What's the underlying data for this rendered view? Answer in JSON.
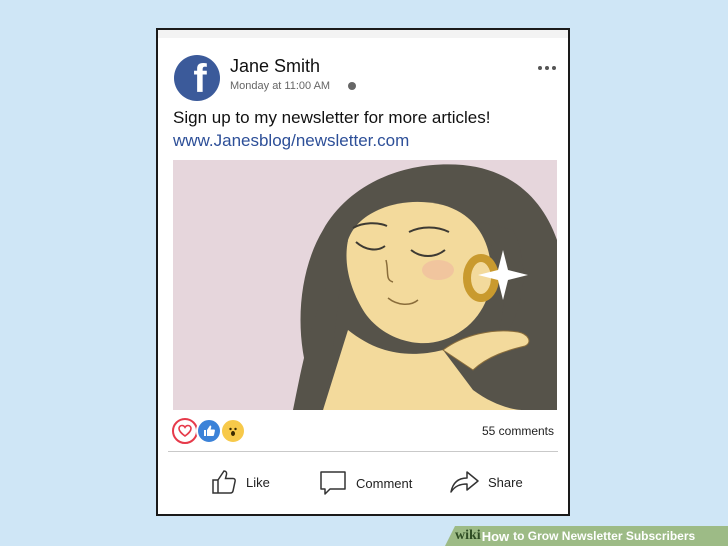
{
  "post": {
    "author_name": "Jane Smith",
    "timestamp": "Monday at 11:00 AM",
    "text": "Sign up to my newsletter for more articles!",
    "link": "www.Janesblog/newsletter.com",
    "comments_count": "55 comments"
  },
  "actions": {
    "like_label": "Like",
    "comment_label": "Comment",
    "share_label": "Share"
  },
  "reactions": [
    "heart-icon",
    "thumbs-up-icon",
    "wow-face-icon"
  ],
  "watermark": {
    "wiki": "wiki",
    "how": "How",
    "title": "to Grow Newsletter Subscribers"
  },
  "colors": {
    "background": "#cfe6f6",
    "facebook_blue": "#3b5a9a",
    "link": "#2d4f98",
    "banner": "#9dbb86"
  }
}
